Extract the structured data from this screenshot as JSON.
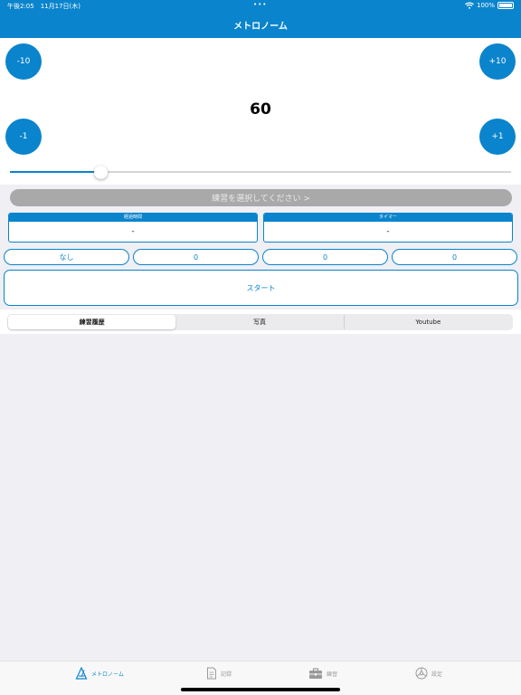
{
  "status_bar": {
    "time": "午後2:05　11月17日(木)",
    "dots": "•••",
    "battery": "100%"
  },
  "header": {
    "title": "メトロノーム"
  },
  "metronome": {
    "minus10_label": "-10",
    "plus10_label": "+10",
    "minus1_label": "-1",
    "plus1_label": "+1",
    "tempo": "60",
    "slider_fraction": 0.18
  },
  "practice": {
    "select_label": "練習を選択してください >",
    "elapsed_header": "経過時間",
    "elapsed_value": "-",
    "timer_header": "タイマー",
    "timer_value": "-"
  },
  "counters": [
    "なし",
    "0",
    "0",
    "0"
  ],
  "start_label": "スタート",
  "segments": [
    "練習履歴",
    "写真",
    "Youtube"
  ],
  "tabs": [
    {
      "label": "メトロノーム",
      "icon": "metronome-icon"
    },
    {
      "label": "記録",
      "icon": "document-icon"
    },
    {
      "label": "練習",
      "icon": "toolbox-icon"
    },
    {
      "label": "設定",
      "icon": "settings-icon"
    }
  ],
  "colors": {
    "accent": "#0a84cc",
    "disabled": "#a9a9a9",
    "background": "#efeff4"
  }
}
